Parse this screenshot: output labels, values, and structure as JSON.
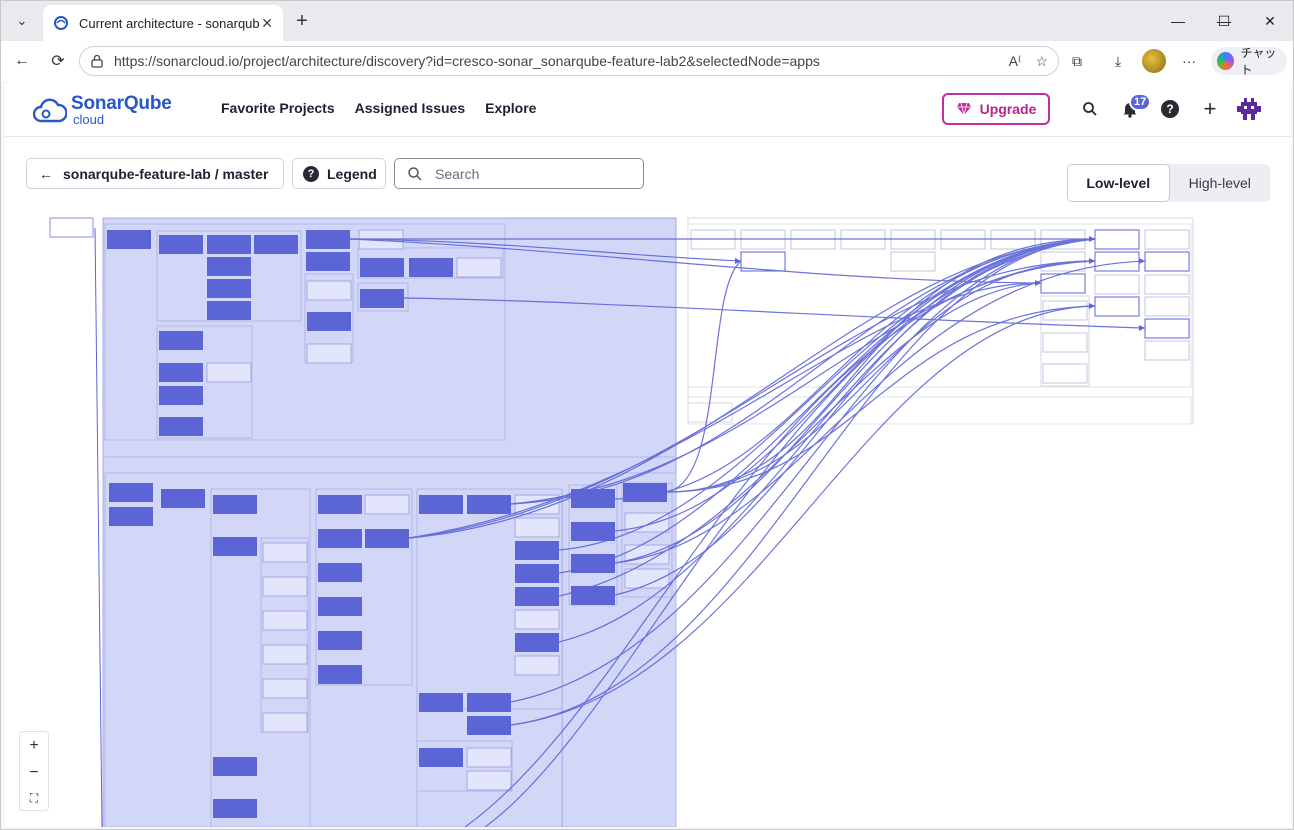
{
  "browser": {
    "tab_title": "Current architecture - sonarqube-f",
    "url": "https://sonarcloud.io/project/architecture/discovery?id=cresco-sonar_sonarqube-feature-lab2&selectedNode=apps",
    "copilot_label": "チャット",
    "icons": {
      "tab_menu": "chevron-down-icon",
      "close_tab": "close-icon",
      "new_tab": "plus-icon",
      "back": "arrow-left-icon",
      "reload": "reload-icon",
      "read_aloud": "read-aloud-icon",
      "favorite": "star-icon",
      "extensions": "puzzle-icon",
      "downloads": "download-icon",
      "more": "ellipsis-icon"
    }
  },
  "app": {
    "logo_name": "SonarQube",
    "logo_sub": "cloud",
    "nav": [
      "Favorite Projects",
      "Assigned Issues",
      "Explore"
    ],
    "upgrade_label": "Upgrade",
    "notification_count": "17",
    "colors": {
      "brand": "#2a56c6",
      "upgrade": "#c22d9f",
      "node": "#5b65d6",
      "selected_area": "#d2d6f7"
    }
  },
  "toolbar": {
    "back_label": "sonarqube-feature-lab / master",
    "legend_label": "Legend",
    "search_placeholder": "Search",
    "level_options": [
      "Low-level",
      "High-level"
    ],
    "active_level": "Low-level"
  },
  "zoom": {
    "in": "+",
    "out": "−",
    "fit": "⛶"
  }
}
